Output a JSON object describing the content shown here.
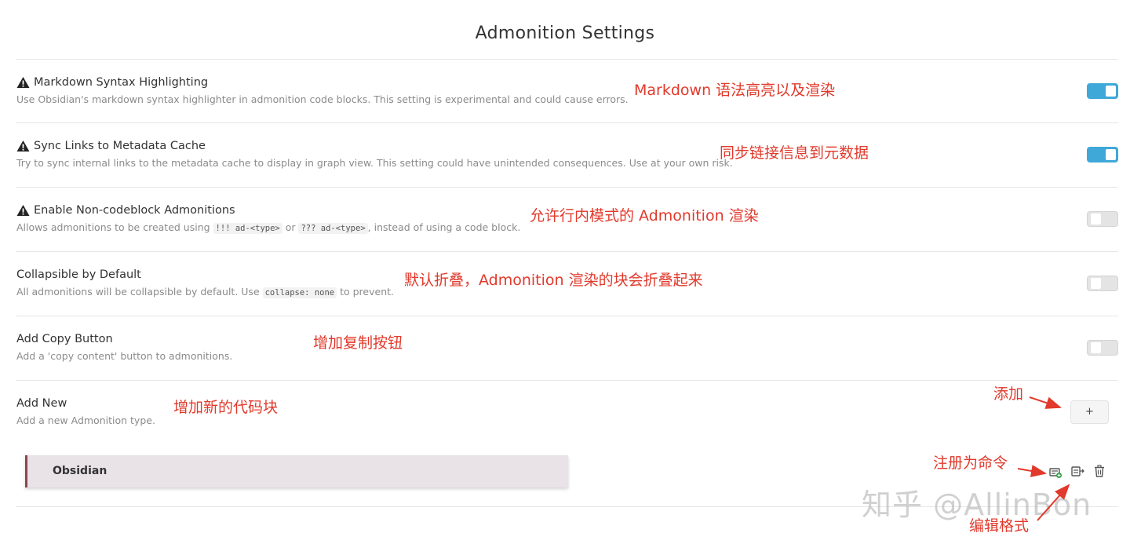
{
  "page": {
    "title": "Admonition Settings"
  },
  "settings": [
    {
      "name": "Markdown Syntax Highlighting",
      "warning": true,
      "desc": "Use Obsidian's markdown syntax highlighter in admonition code blocks. This setting is experimental and could cause errors.",
      "toggle": "on"
    },
    {
      "name": "Sync Links to Metadata Cache",
      "warning": true,
      "desc": "Try to sync internal links to the metadata cache to display in graph view. This setting could have unintended consequences. Use at your own risk.",
      "toggle": "on"
    },
    {
      "name": "Enable Non-codeblock Admonitions",
      "warning": true,
      "desc_pre": "Allows admonitions to be created using ",
      "desc_code1": "!!! ad-<type>",
      "desc_mid": " or ",
      "desc_code2": "??? ad-<type>",
      "desc_post": ", instead of using a code block.",
      "toggle": "off"
    },
    {
      "name": "Collapsible by Default",
      "warning": false,
      "desc_pre": "All admonitions will be collapsible by default. Use ",
      "desc_code1": "collapse: none",
      "desc_post": " to prevent.",
      "toggle": "off"
    },
    {
      "name": "Add Copy Button",
      "warning": false,
      "desc": "Add a 'copy content' button to admonitions.",
      "toggle": "off"
    },
    {
      "name": "Add New",
      "warning": false,
      "desc": "Add a new Admonition type.",
      "button_label": "+"
    }
  ],
  "admonition": {
    "title": "Obsidian",
    "color": "#8a4651"
  },
  "annotations": {
    "n1": "Markdown 语法高亮以及渲染",
    "n2": "同步链接信息到元数据",
    "n3": "允许行内模式的 Admonition 渲染",
    "n4": "默认折叠，Admonition 渲染的块会折叠起来",
    "n5": "增加复制按钮",
    "n6": "增加新的代码块",
    "add": "添加",
    "register": "注册为命令",
    "edit": "编辑格式"
  },
  "watermark": "知乎 @AllinBon",
  "colors": {
    "accent": "#3fa8d9",
    "annotation": "#e1392b"
  },
  "icons": [
    "warning-icon",
    "register-command-icon",
    "edit-icon",
    "delete-icon"
  ]
}
